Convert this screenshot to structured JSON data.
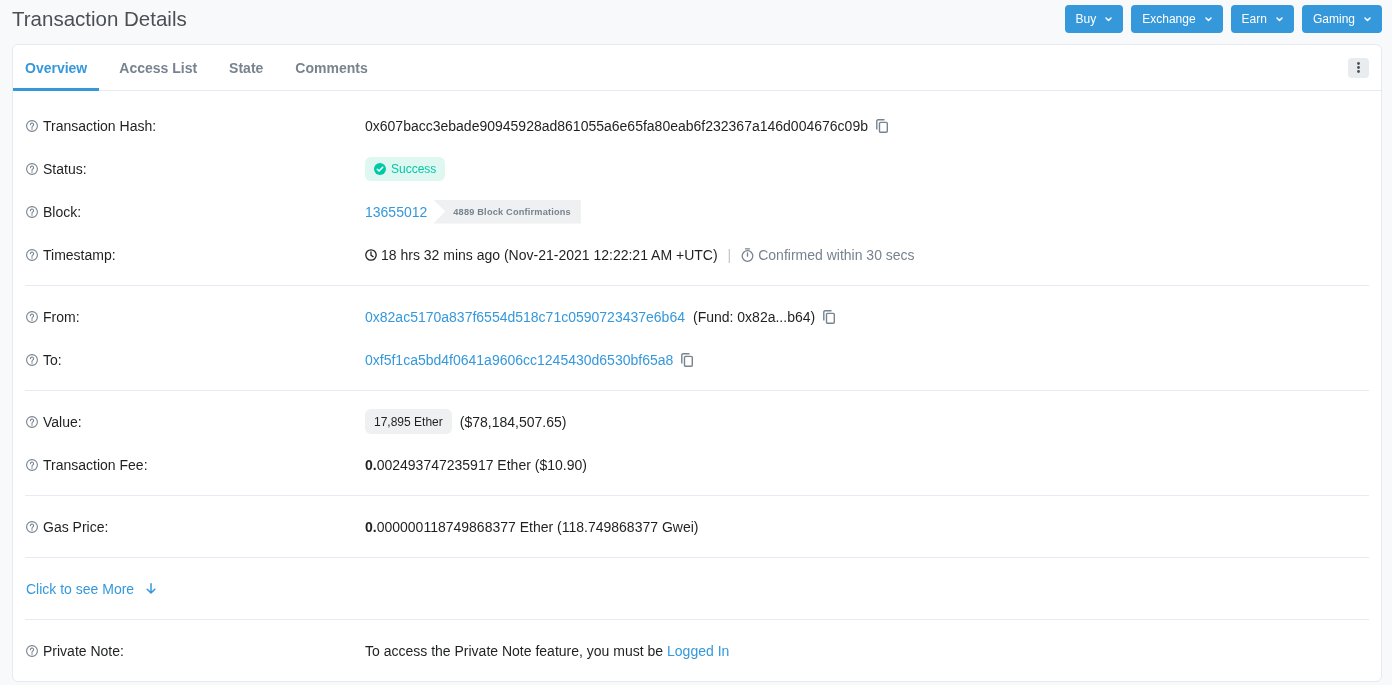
{
  "page_title": "Transaction Details",
  "nav_buttons": [
    "Buy",
    "Exchange",
    "Earn",
    "Gaming"
  ],
  "tabs": [
    {
      "label": "Overview",
      "selected": true
    },
    {
      "label": "Access List",
      "selected": false
    },
    {
      "label": "State",
      "selected": false
    },
    {
      "label": "Comments",
      "selected": false
    }
  ],
  "sections": [
    {
      "rows": [
        {
          "kind": "hash",
          "label": "Transaction Hash:",
          "value": "0x607bacc3ebade90945928ad861055a6e65fa80eab6f232367a146d004676c09b"
        },
        {
          "kind": "status",
          "label": "Status:",
          "status": "Success"
        },
        {
          "kind": "block",
          "label": "Block:",
          "block": "13655012",
          "confirmations": "4889 Block Confirmations"
        },
        {
          "kind": "timestamp",
          "label": "Timestamp:",
          "age": "18 hrs 32 mins ago (Nov-21-2021 12:22:21 AM +UTC)",
          "separator": "|",
          "confirmed": "Confirmed within 30 secs"
        }
      ]
    },
    {
      "rows": [
        {
          "kind": "address",
          "label": "From:",
          "address": "0x82ac5170a837f6554d518c71c0590723437e6b64",
          "note": "(Fund: 0x82a...b64)"
        },
        {
          "kind": "address",
          "label": "To:",
          "address": "0xf5f1ca5bd4f0641a9606cc1245430d6530bf65a8"
        }
      ]
    },
    {
      "rows": [
        {
          "kind": "amount",
          "label": "Value:",
          "amount": "17,895 Ether",
          "fiat": "($78,184,507.65)"
        },
        {
          "kind": "text",
          "label": "Transaction Fee:",
          "value": "**0.**002493747235917 Ether ($10.90)"
        }
      ]
    },
    {
      "rows": [
        {
          "kind": "text",
          "label": "Gas Price:",
          "value": "**0.**000000118749868377 Ether (118.749868377 Gwei)"
        }
      ]
    },
    {
      "rows": [
        {
          "kind": "more",
          "link": "Click to see More"
        }
      ]
    },
    {
      "rows": [
        {
          "kind": "note",
          "label": "Private Note:",
          "text": "To access the Private Note feature, you must be",
          "link": "Logged In"
        }
      ]
    }
  ]
}
